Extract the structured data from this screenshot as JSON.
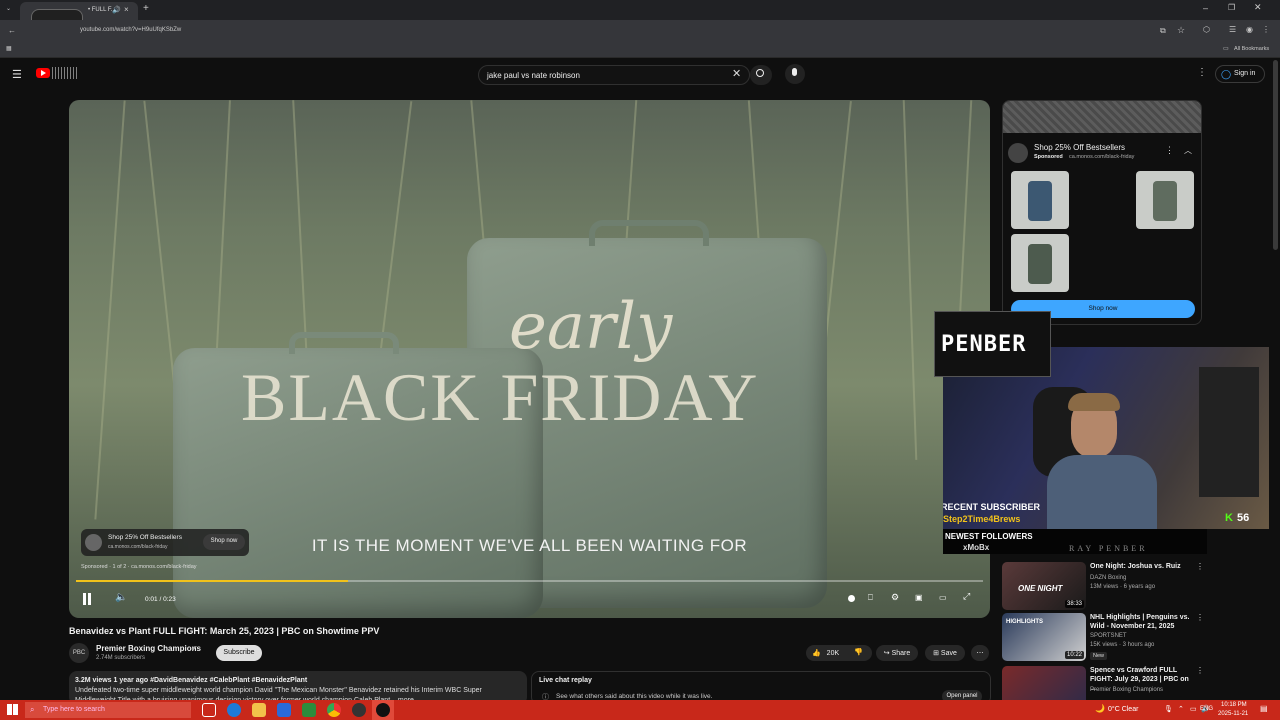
{
  "browser": {
    "tab_title": "• FULL F...",
    "url": "youtube.com/watch?v=H9uUfqKSbZw",
    "bookmarks_label": "All Bookmarks"
  },
  "header": {
    "search_value": "jake paul vs nate robinson",
    "sign_in": "Sign in"
  },
  "video": {
    "overlay_early": "early",
    "overlay_title": "BLACK FRIDAY",
    "caption": "IT IS THE MOMENT WE'VE ALL BEEN WAITING FOR",
    "ad_card_title": "Shop 25% Off Bestsellers",
    "ad_card_url": "ca.monos.com/black-friday",
    "ad_card_button": "Shop now",
    "sponsored_line": "Sponsored · 1 of 2 · ca.monos.com/black-friday",
    "time": "0:01 / 0:23",
    "progress": 0.3
  },
  "info": {
    "title": "Benavidez vs Plant FULL FIGHT: March 25, 2023 | PBC on Showtime PPV",
    "channel": "Premier Boxing Champions",
    "subscribers": "2.74M subscribers",
    "subscribe": "Subscribe",
    "likes": "20K",
    "share": "Share",
    "save": "Save",
    "desc_meta": "3.2M views  1 year ago  #DavidBenavidez #CalebPlant #BenavidezPlant",
    "desc_text": "Undefeated two-time super middleweight world champion David \"The Mexican Monster\" Benavidez retained his Interim WBC Super",
    "desc_text2": "Middleweight Title with a bruising unanimous decision victory over former world champion Caleb Plant ...more",
    "chat_title": "Live chat replay",
    "chat_sub": "See what others said about this video while it was live.",
    "chat_button": "Open panel"
  },
  "ad_panel": {
    "title": "Shop 25% Off Bestsellers",
    "sponsored": "Sponsored",
    "url": "ca.monos.com/black-friday",
    "button": "Shop now"
  },
  "stream": {
    "logo_text": "PENBER",
    "recent_sub_label": "RECENT SUBSCRIBER",
    "recent_sub_name": "Step2Time4Brews",
    "newest_followers_label": "NEWEST FOLLOWERS",
    "newest_followers_name": "xMoBx",
    "viewer_count": "56",
    "banner": "RAY PENBER"
  },
  "recommendations": [
    {
      "title": "One Night: Joshua vs. Ruiz",
      "channel": "DAZN Boxing",
      "meta": "13M views · 6 years ago",
      "duration": "38:33",
      "thumb_text": "ONE NIGHT",
      "badge": ""
    },
    {
      "title": "NHL Highlights | Penguins vs. Wild - November 21, 2025",
      "channel": "SPORTSNET",
      "meta": "15K views · 3 hours ago",
      "duration": "10:22",
      "thumb_text": "HIGHLIGHTS",
      "badge": "New"
    },
    {
      "title": "Spence vs Crawford FULL FIGHT: July 29, 2023 | PBC on ...",
      "channel": "Premier Boxing Champions",
      "meta": "",
      "duration": "",
      "thumb_text": "",
      "badge": ""
    }
  ],
  "taskbar": {
    "search_placeholder": "Type here to search",
    "weather": "0°C  Clear",
    "lang": "ENG",
    "time": "10:18 PM",
    "date": "2025-11-21"
  },
  "colors": {
    "accent": "#f1c21b",
    "yt_red": "#ff0000",
    "taskbar": "#c8281a",
    "shop_blue": "#3ea6ff"
  }
}
